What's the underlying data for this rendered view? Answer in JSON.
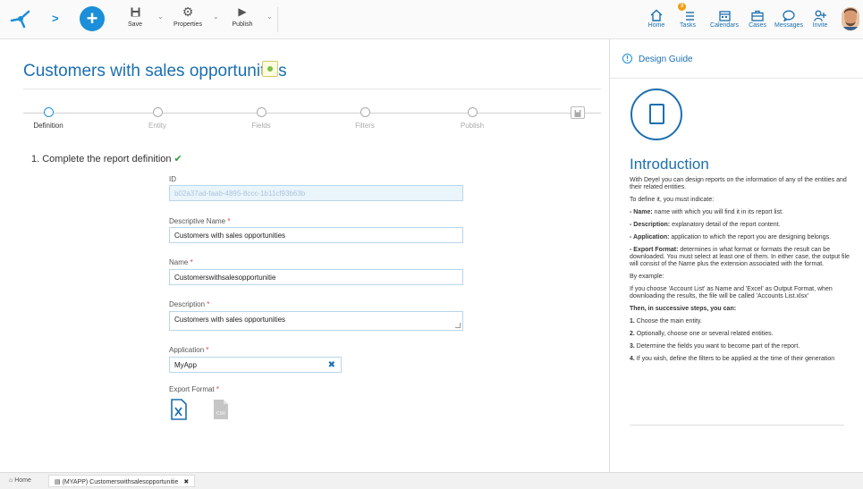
{
  "toolbar": {
    "save_label": "Save",
    "properties_label": "Properties",
    "publish_label": "Publish"
  },
  "nav": {
    "home": "Home",
    "tasks": "Tasks",
    "tasks_badge": "3",
    "calendars": "Calendars",
    "cases": "Cases",
    "messages": "Messages",
    "invite": "Invite"
  },
  "page": {
    "title": "Customers with sales opportunities"
  },
  "steps": [
    "Definition",
    "Entity",
    "Fields",
    "Filters",
    "Publish"
  ],
  "section": {
    "title": "1. Complete the report definition",
    "check": "✔"
  },
  "form": {
    "id_label": "ID",
    "id_value": "b02a37ad-faab-4895-8ccc-1b11cf93b63b",
    "descriptive_name_label": "Descriptive Name",
    "descriptive_name_value": "Customers with sales opportunities",
    "name_label": "Name",
    "name_value": "Customerswithsalesopportunitie",
    "description_label": "Description",
    "description_value": "Customers with sales opportunities",
    "application_label": "Application",
    "application_value": "MyApp",
    "export_format_label": "Export Format",
    "required_mark": "*",
    "clear_symbol": "✖"
  },
  "guide": {
    "header": "Design Guide",
    "intro": "Introduction",
    "p1": "With Deyel you can design reports on the information of any of the entities and their related entities.",
    "p2": "To define it, you must indicate:",
    "name_term": "- Name:",
    "name_desc": " name with which you will find it in its report list.",
    "desc_term": "- Description:",
    "desc_desc": " explanatory detail of the report content.",
    "app_term": "- Application:",
    "app_desc": " application to which the report you are designing belongs.",
    "export_term": "- Export Format:",
    "export_desc": " determines in what format or formats the result can be downloaded. You must select at least one of them. In either case, the output file will consist of the Name plus the extension associated with the format.",
    "example_intro": "By example:",
    "example": "If you choose 'Account List' as Name and 'Excel' as Output Format, when downloading the results, the file will be called 'Accounts List.xlsx'",
    "then": "Then, in successive steps, you can:",
    "s1_num": "1.",
    "s1": " Choose the main entity.",
    "s2_num": "2.",
    "s2": " Optionally, choose one or several related entities.",
    "s3_num": "3.",
    "s3": " Determine the fields you want to become part of the report.",
    "s4_num": "4.",
    "s4": " If you wish, define the filters to be applied at the time of their generation"
  },
  "bottom": {
    "home_tab": "Home",
    "doc_tab": "(MYAPP) Customerswithsalesopportunitie",
    "close": "✖"
  },
  "colors": {
    "accent": "#1b8fd9",
    "title_blue": "#1b6fb0",
    "required": "#e04040",
    "success": "#2e9e3a"
  }
}
